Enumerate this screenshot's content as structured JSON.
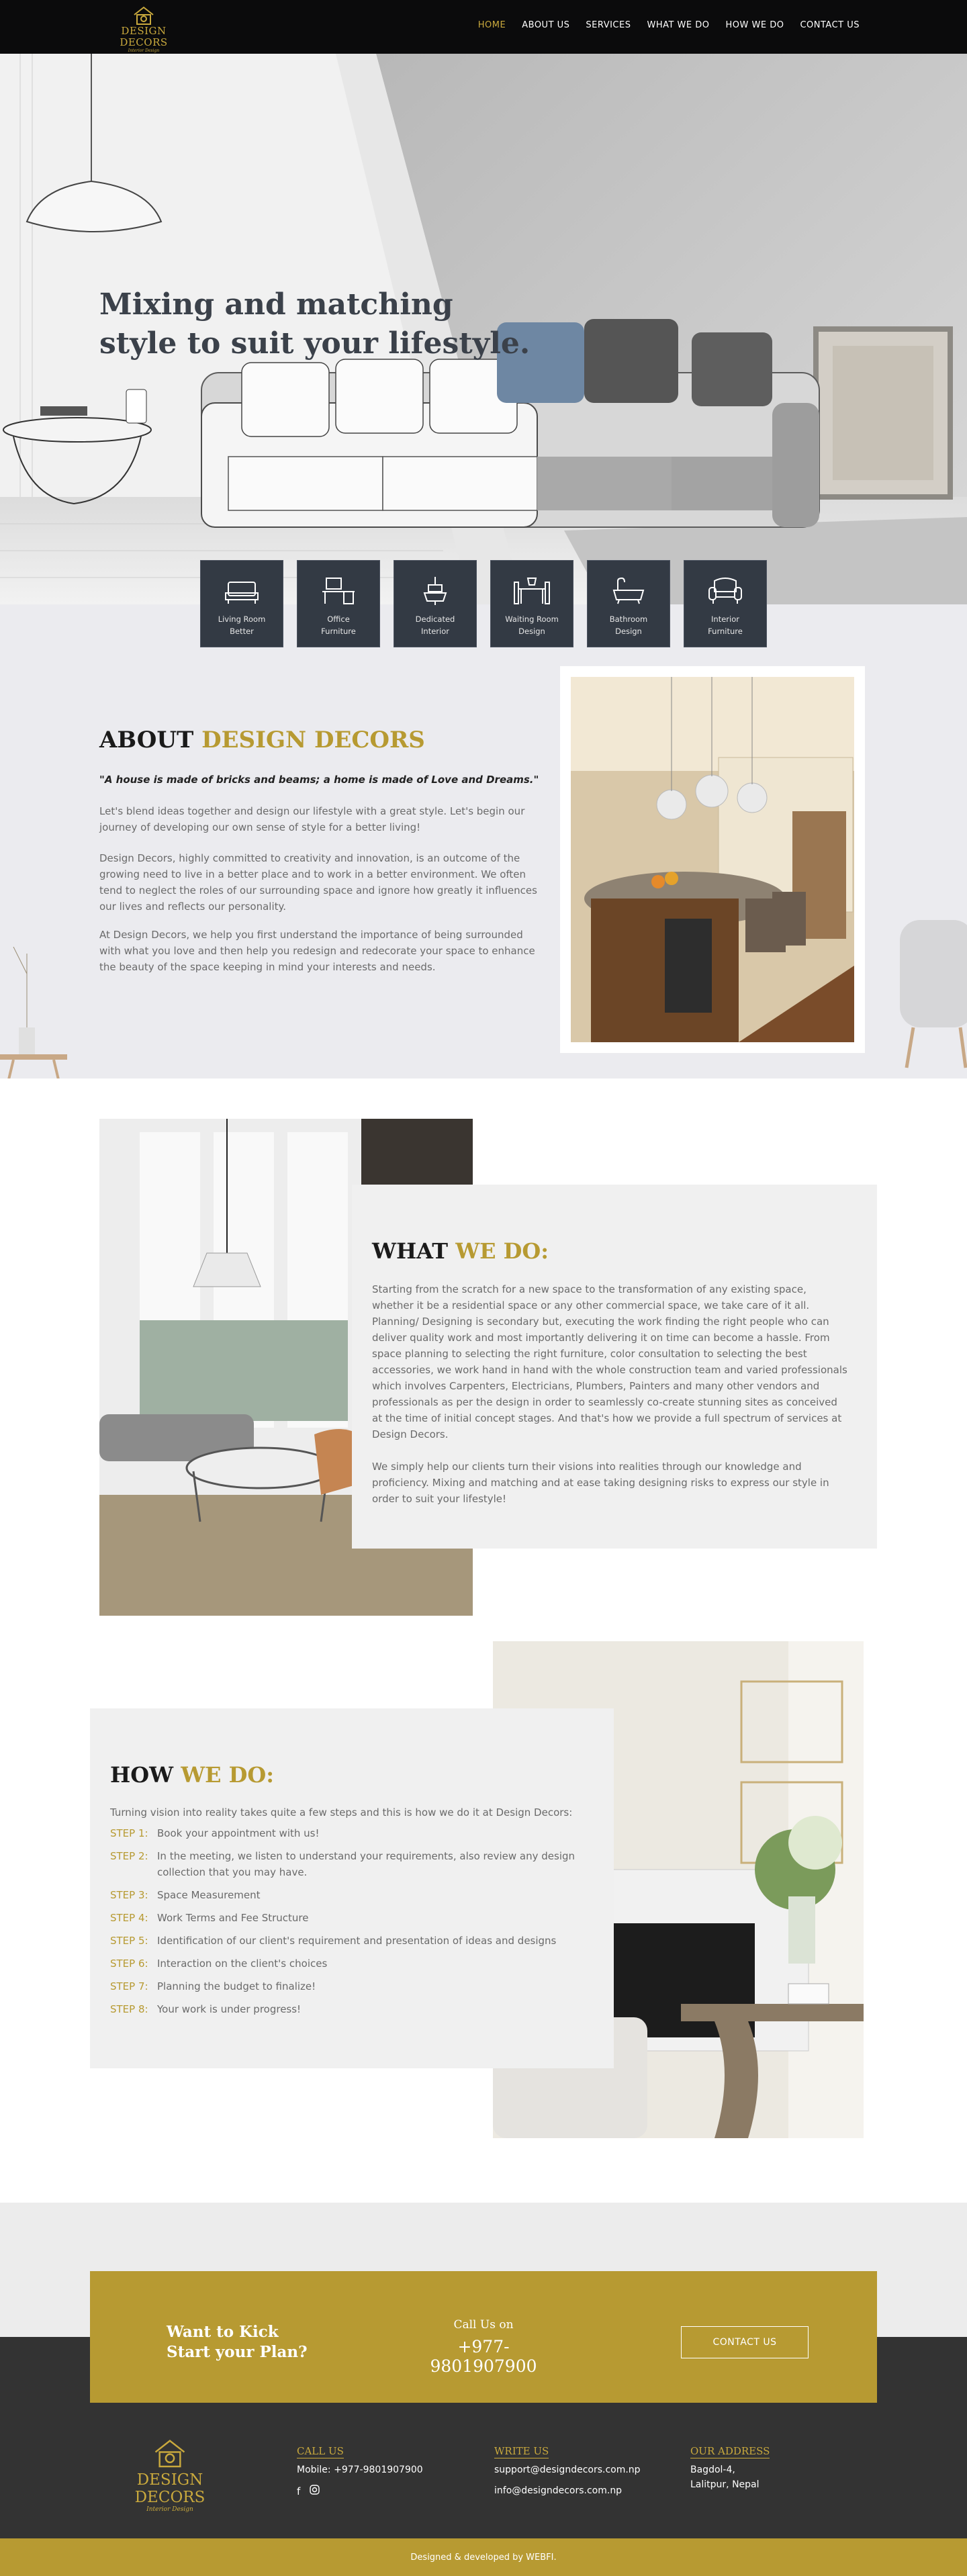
{
  "nav": {
    "logo": {
      "brand": "DESIGN DECORS",
      "tagline": "Interior Design"
    },
    "items": [
      {
        "label": "HOME",
        "active": true
      },
      {
        "label": "ABOUT US"
      },
      {
        "label": "SERVICES"
      },
      {
        "label": "WHAT WE DO"
      },
      {
        "label": "HOW WE DO"
      },
      {
        "label": "CONTACT US"
      }
    ]
  },
  "hero": {
    "line1": "Mixing and matching",
    "line2": "style to suit your lifestyle."
  },
  "tiles": [
    {
      "icon": "bed-icon",
      "line1": "Living Room",
      "line2": "Better"
    },
    {
      "icon": "desk-icon",
      "line1": "Office",
      "line2": "Furniture"
    },
    {
      "icon": "lamp-icon",
      "line1": "Dedicated",
      "line2": "Interior"
    },
    {
      "icon": "dining-icon",
      "line1": "Waiting Room",
      "line2": "Design"
    },
    {
      "icon": "bathtub-icon",
      "line1": "Bathroom",
      "line2": "Design"
    },
    {
      "icon": "armchair-icon",
      "line1": "Interior",
      "line2": "Furniture"
    }
  ],
  "about": {
    "title_prefix": "ABOUT ",
    "title_highlight": "DESIGN DECORS",
    "quote": "\"A house is made of bricks and beams; a home is made of Love and Dreams.\"",
    "p1": "Let's blend ideas together and design our lifestyle with a great style. Let's begin our journey of developing our own sense of style for a better living!",
    "p2": "Design Decors, highly committed to creativity and innovation, is an outcome of the growing need to live in a better place and to work in a better environment. We often tend to neglect the roles of our surrounding space and ignore how greatly it influences our lives and reflects our personality.",
    "p3": "At Design Decors, we help you first understand the importance of being surrounded with what you love and then help you redesign and redecorate your space to enhance the beauty of the space keeping in mind your interests and needs."
  },
  "what": {
    "title_prefix": "WHAT ",
    "title_highlight": "WE DO:",
    "p1": "Starting from the scratch for a new space to the transformation of any existing space, whether it be a residential space or any other commercial space, we take care of it all. Planning/ Designing is secondary but, executing the work finding the right people who can deliver quality work and most importantly delivering it on time can become a hassle. From space planning to selecting the right furniture, color consultation to selecting the best accessories, we work hand in hand with the whole construction team and varied professionals which involves Carpenters, Electricians, Plumbers, Painters and many other vendors and professionals as per the design in order to seamlessly co-create stunning sites as conceived at the time of initial concept stages. And that's how we provide a full spectrum of services at Design Decors.",
    "p2": "We simply help our clients turn their visions into realities through our knowledge and proficiency. Mixing and matching and at ease taking designing risks to express our style in order to suit your lifestyle!"
  },
  "how": {
    "title_prefix": "HOW ",
    "title_highlight": "WE DO:",
    "intro": "Turning vision into reality takes quite a few steps and this is how we do it at Design Decors:",
    "steps": [
      {
        "n": "STEP 1:",
        "text": "Book your appointment with us!"
      },
      {
        "n": "STEP 2:",
        "text": "In the meeting, we listen to understand your requirements, also review any design collection that you may have."
      },
      {
        "n": "STEP 3:",
        "text": "Space Measurement"
      },
      {
        "n": "STEP 4:",
        "text": "Work Terms and Fee Structure"
      },
      {
        "n": "STEP 5:",
        "text": "Identification of our client's requirement and presentation of ideas and designs"
      },
      {
        "n": "STEP 6:",
        "text": "Interaction on the client's choices"
      },
      {
        "n": "STEP 7:",
        "text": "Planning the budget to finalize!"
      },
      {
        "n": "STEP 8:",
        "text": "Your work is under progress!"
      }
    ]
  },
  "cta": {
    "kick1": "Want to Kick",
    "kick2": "Start your Plan?",
    "call_title": "Call Us on",
    "phone": "+977-9801907900",
    "button": "CONTACT US"
  },
  "footer": {
    "logo": {
      "brand": "DESIGN DECORS",
      "tagline": "Interior Design"
    },
    "call": {
      "title": "CALL US",
      "mobile": "Mobile: +977-9801907900"
    },
    "write": {
      "title": "WRITE US",
      "email1": "support@designdecors.com.np",
      "email2": "info@designdecors.com.np"
    },
    "address": {
      "title": "OUR ADDRESS",
      "line1": "Bagdol-4,",
      "line2": "Lalitpur, Nepal"
    },
    "social": [
      "facebook-icon",
      "instagram-icon"
    ],
    "credit": "Designed & developed by WEBFI."
  },
  "colors": {
    "gold": "#b79a32",
    "dark": "#333a44",
    "nav": "#0b0b0c",
    "footer": "#333333"
  }
}
